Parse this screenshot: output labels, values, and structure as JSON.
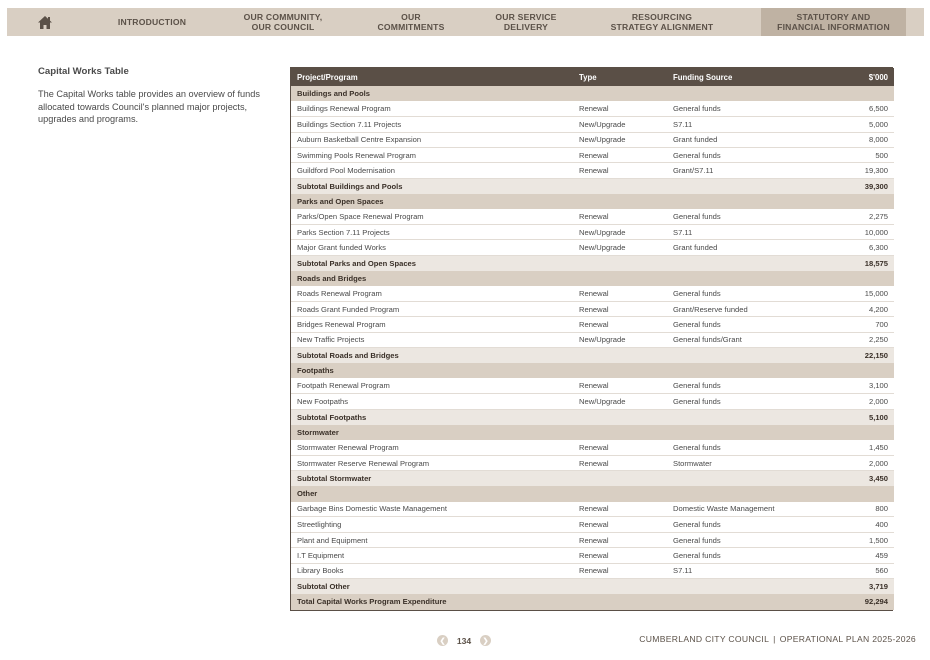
{
  "nav": {
    "home_icon": "home-icon",
    "items": [
      {
        "label": "INTRODUCTION"
      },
      {
        "label": "OUR COMMUNITY,\nOUR COUNCIL"
      },
      {
        "label": "OUR\nCOMMITMENTS"
      },
      {
        "label": "OUR SERVICE\nDELIVERY"
      },
      {
        "label": "RESOURCING\nSTRATEGY ALIGNMENT"
      },
      {
        "label": "STATUTORY AND\nFINANCIAL INFORMATION"
      }
    ]
  },
  "intro": {
    "title": "Capital Works Table",
    "text": "The Capital Works table provides an overview of funds allocated towards Council's planned major projects, upgrades and programs."
  },
  "table": {
    "headers": [
      "Project/Program",
      "Type",
      "Funding Source",
      "$'000"
    ],
    "sections": [
      {
        "name": "Buildings and Pools",
        "rows": [
          [
            "Buildings Renewal Program",
            "Renewal",
            "General funds",
            "6,500"
          ],
          [
            "Buildings Section 7.11 Projects",
            "New/Upgrade",
            "S7.11",
            "5,000"
          ],
          [
            "Auburn Basketball Centre Expansion",
            "New/Upgrade",
            "Grant funded",
            "8,000"
          ],
          [
            "Swimming Pools Renewal Program",
            "Renewal",
            "General funds",
            "500"
          ],
          [
            "Guildford Pool Modernisation",
            "Renewal",
            "Grant/S7.11",
            "19,300"
          ]
        ],
        "subtotal_label": "Subtotal Buildings and Pools",
        "subtotal": "39,300"
      },
      {
        "name": "Parks and Open Spaces",
        "rows": [
          [
            "Parks/Open Space Renewal Program",
            "Renewal",
            "General funds",
            "2,275"
          ],
          [
            "Parks Section 7.11 Projects",
            "New/Upgrade",
            "S7.11",
            "10,000"
          ],
          [
            "Major Grant funded Works",
            "New/Upgrade",
            "Grant funded",
            "6,300"
          ]
        ],
        "subtotal_label": "Subtotal Parks and Open Spaces",
        "subtotal": "18,575"
      },
      {
        "name": "Roads and Bridges",
        "rows": [
          [
            "Roads Renewal Program",
            "Renewal",
            "General funds",
            "15,000"
          ],
          [
            "Roads Grant Funded Program",
            "Renewal",
            "Grant/Reserve funded",
            "4,200"
          ],
          [
            "Bridges Renewal Program",
            "Renewal",
            "General funds",
            "700"
          ],
          [
            "New Traffic Projects",
            "New/Upgrade",
            "General funds/Grant",
            "2,250"
          ]
        ],
        "subtotal_label": "Subtotal Roads and Bridges",
        "subtotal": "22,150"
      },
      {
        "name": "Footpaths",
        "rows": [
          [
            "Footpath Renewal Program",
            "Renewal",
            "General funds",
            "3,100"
          ],
          [
            "New Footpaths",
            "New/Upgrade",
            "General funds",
            "2,000"
          ]
        ],
        "subtotal_label": "Subtotal Footpaths",
        "subtotal": "5,100"
      },
      {
        "name": "Stormwater",
        "rows": [
          [
            "Stormwater Renewal Program",
            "Renewal",
            "General funds",
            "1,450"
          ],
          [
            "Stormwater Reserve Renewal Program",
            "Renewal",
            "Stormwater",
            "2,000"
          ]
        ],
        "subtotal_label": "Subtotal Stormwater",
        "subtotal": "3,450"
      },
      {
        "name": "Other",
        "rows": [
          [
            "Garbage Bins Domestic Waste Management",
            "Renewal",
            "Domestic Waste Management",
            "800"
          ],
          [
            "Streetlighting",
            "Renewal",
            "General funds",
            "400"
          ],
          [
            "Plant and Equipment",
            "Renewal",
            "General funds",
            "1,500"
          ],
          [
            "I.T Equipment",
            "Renewal",
            "General funds",
            "459"
          ],
          [
            "Library Books",
            "Renewal",
            "S7.11",
            "560"
          ]
        ],
        "subtotal_label": "Subtotal Other",
        "subtotal": "3,719"
      }
    ],
    "total_label": "Total Capital Works Program Expenditure",
    "total": "92,294"
  },
  "footer": {
    "page_number": "134",
    "prev_icon": "chevron-left-icon",
    "next_icon": "chevron-right-icon",
    "council": "CUMBERLAND CITY COUNCIL",
    "separator": "|",
    "plan": "OPERATIONAL PLAN 2025-2026"
  },
  "colors": {
    "nav_bg": "#d9cfc3",
    "nav_active": "#bfb2a3",
    "table_header": "#5a4f46",
    "section_bg": "#d9cfc3",
    "subtotal_bg": "#ece7e1"
  }
}
